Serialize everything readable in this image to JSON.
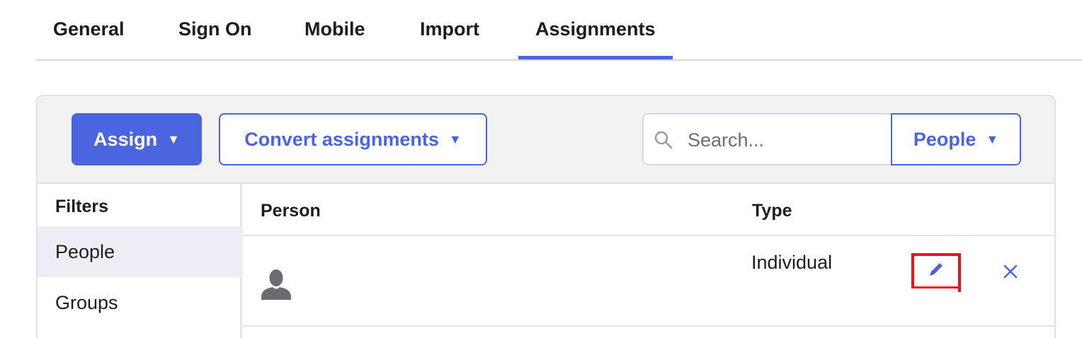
{
  "tabs": [
    {
      "label": "General"
    },
    {
      "label": "Sign On"
    },
    {
      "label": "Mobile"
    },
    {
      "label": "Import"
    },
    {
      "label": "Assignments",
      "active": true
    }
  ],
  "toolbar": {
    "assign_label": "Assign",
    "convert_label": "Convert assignments",
    "search_placeholder": "Search...",
    "people_label": "People",
    "caret": "▼"
  },
  "filters": {
    "title": "Filters",
    "items": [
      {
        "label": "People",
        "selected": true
      },
      {
        "label": "Groups"
      }
    ]
  },
  "table": {
    "columns": [
      "Person",
      "Type"
    ],
    "rows": [
      {
        "person": "",
        "type": "Individual"
      }
    ]
  },
  "icons": {
    "search": "search-icon",
    "avatar": "user-avatar-icon",
    "edit": "pencil-icon",
    "remove": "close-icon"
  },
  "colors": {
    "accent": "#4b64e0",
    "highlight_box": "#e8141b",
    "panel_bg": "#f2f2f3"
  }
}
